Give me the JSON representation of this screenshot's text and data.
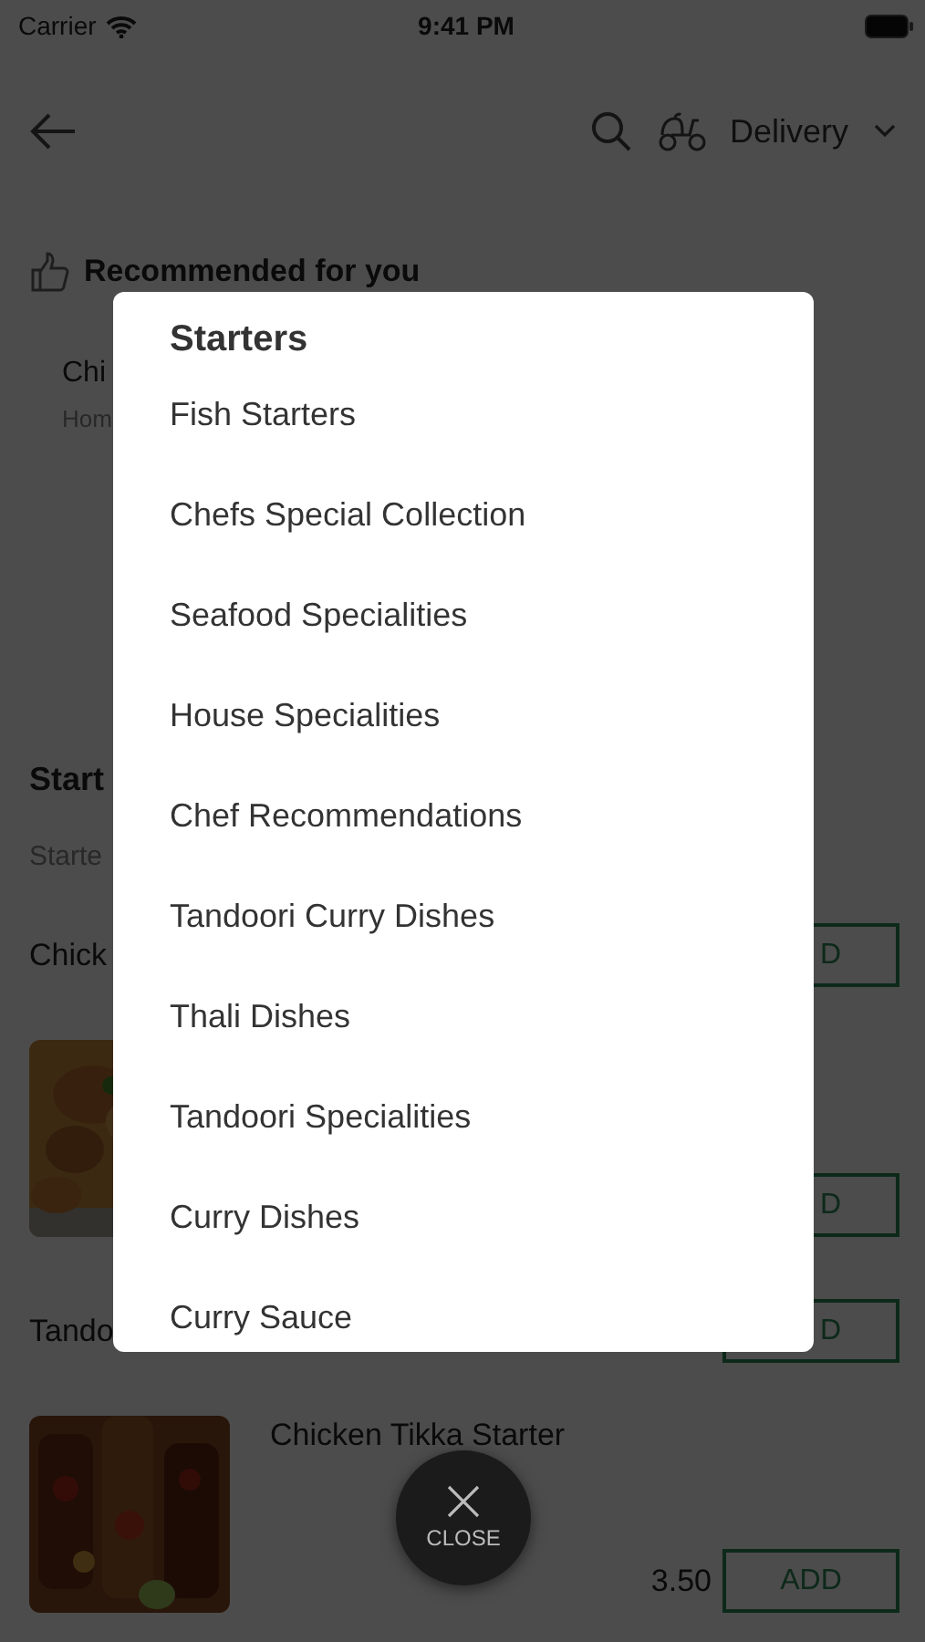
{
  "status_bar": {
    "carrier": "Carrier",
    "time": "9:41 PM"
  },
  "header": {
    "order_mode": "Delivery"
  },
  "recommended": {
    "title": "Recommended for you",
    "item_name": "Chi",
    "item_subtitle": "Hom"
  },
  "section": {
    "title": "Start",
    "subtitle": "Starte"
  },
  "menu_items": [
    {
      "kind": "text",
      "name": "Chick",
      "add_label": "D"
    },
    {
      "kind": "picture",
      "add_label": "D"
    },
    {
      "kind": "text",
      "name": "Tando",
      "add_label": "D"
    },
    {
      "kind": "picture",
      "name": "Chicken Tikka Starter",
      "price": "3.50",
      "add_label": "ADD"
    }
  ],
  "category_sheet": {
    "title": "Starters",
    "items": [
      "Fish Starters",
      "Chefs Special Collection",
      "Seafood Specialities",
      "House Specialities",
      "Chef Recommendations",
      "Tandoori Curry Dishes",
      "Thali Dishes",
      "Tandoori Specialities",
      "Curry Dishes",
      "Curry Sauce"
    ]
  },
  "close_button": {
    "label": "CLOSE"
  }
}
